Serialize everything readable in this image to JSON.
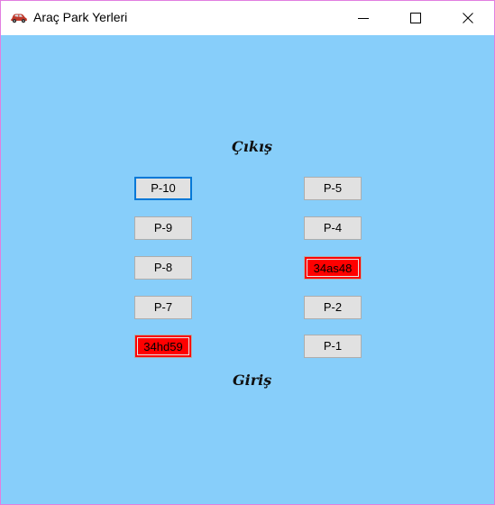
{
  "window": {
    "title": "Araç Park Yerleri",
    "background_color": "#87cefa",
    "border_color": "#e27ee0",
    "icon": "car-icon"
  },
  "title_controls": {
    "minimize_icon": "minimize-icon",
    "maximize_icon": "maximize-icon",
    "close_icon": "close-icon"
  },
  "labels": {
    "exit": "Çıkış",
    "entry": "Giriş"
  },
  "slots": {
    "left": [
      {
        "label": "P-10",
        "occupied": false,
        "focused": true
      },
      {
        "label": "P-9",
        "occupied": false,
        "focused": false
      },
      {
        "label": "P-8",
        "occupied": false,
        "focused": false
      },
      {
        "label": "P-7",
        "occupied": false,
        "focused": false
      },
      {
        "label": "34hd59",
        "occupied": true,
        "focused": false
      }
    ],
    "right": [
      {
        "label": "P-5",
        "occupied": false,
        "focused": false
      },
      {
        "label": "P-4",
        "occupied": false,
        "focused": false
      },
      {
        "label": "34as48",
        "occupied": true,
        "focused": false
      },
      {
        "label": "P-2",
        "occupied": false,
        "focused": false
      },
      {
        "label": "P-1",
        "occupied": false,
        "focused": false
      }
    ]
  },
  "colors": {
    "empty_slot": "#e1e1e1",
    "occupied_slot": "#ff0000",
    "focus": "#0078d7"
  }
}
